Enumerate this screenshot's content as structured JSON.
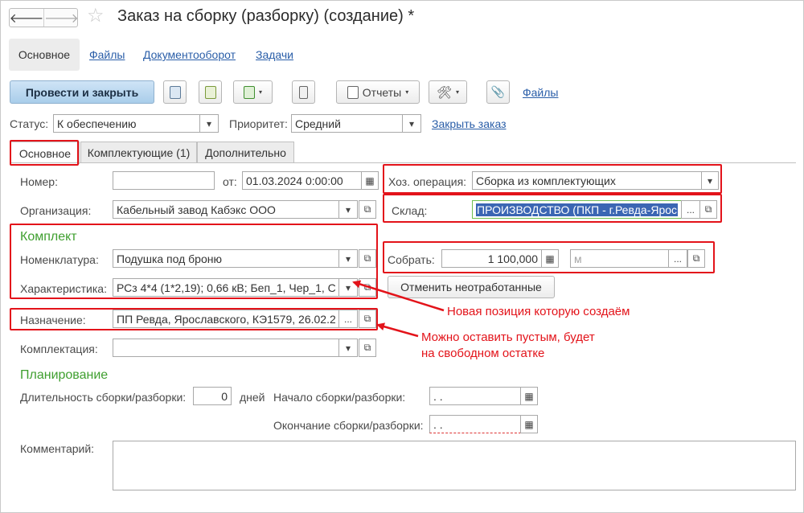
{
  "window": {
    "title": "Заказ на сборку (разборку) (создание) *",
    "back_glyph": "🡐",
    "forward_glyph": "🡒",
    "star_glyph": "☆"
  },
  "sections": {
    "main": "Основное",
    "files": "Файлы",
    "docflow": "Документооборот",
    "tasks": "Задачи"
  },
  "toolbar": {
    "post_close": "Провести и закрыть",
    "reports": "Отчеты",
    "files": "Файлы",
    "tools_glyph": "🛠",
    "clip_glyph": "📎",
    "dd_glyph": "▾"
  },
  "status": {
    "status_label": "Статус:",
    "status_value": "К обеспечению",
    "priority_label": "Приоритет:",
    "priority_value": "Средний",
    "close_order": "Закрыть заказ"
  },
  "tabs": [
    "Основное",
    "Комплектующие (1)",
    "Дополнительно"
  ],
  "form": {
    "number_label": "Номер:",
    "number_value": "",
    "from_label": "от:",
    "date_value": "01.03.2024  0:00:00",
    "org_label": "Организация:",
    "org_value": "Кабельный завод Кабэкс ООО",
    "op_label": "Хоз. операция:",
    "op_value": "Сборка из комплектующих",
    "warehouse_label": "Склад:",
    "warehouse_value": "ПРОИЗВОДСТВО (ПКП - г.Ревда-Ярос",
    "kit_title": "Комплект",
    "nom_label": "Номенклатура:",
    "nom_value": "Подушка под броню",
    "char_label": "Характеристика:",
    "char_value": "РСз 4*4 (1*2,19); 0,66 кВ; Беп_1, Чер_1, С",
    "assemble_label": "Собрать:",
    "assemble_value": "1 100,000",
    "unit_placeholder": "м",
    "cancel_btn": "Отменить неотработанные",
    "purpose_label": "Назначение:",
    "purpose_value": "ПП Ревда, Ярославского, КЭ1579, 26.02.2",
    "complect_label": "Комплектация:",
    "complect_value": "",
    "plan_title": "Планирование",
    "duration_label": "Длительность сборки/разборки:",
    "duration_value": "0",
    "days_label": "дней",
    "start_label": "Начало сборки/разборки:",
    "start_value": " .  .",
    "end_label": "Окончание сборки/разборки:",
    "end_value": " .  .",
    "comment_label": "Комментарий:",
    "ellipsis": "...",
    "open_glyph": "⧉",
    "calendar_glyph": "▦",
    "calc_glyph": "▦"
  },
  "annotations": {
    "new_position": "Новая позиция которую создаём",
    "can_leave_empty_1": "Можно оставить пустым, будет",
    "can_leave_empty_2": "на свободном остатке"
  },
  "colors": {
    "annotation_red": "#e3131a",
    "group_green": "#3f9f2f",
    "link_blue": "#2a5ea8",
    "selection_blue": "#3b66b3"
  }
}
